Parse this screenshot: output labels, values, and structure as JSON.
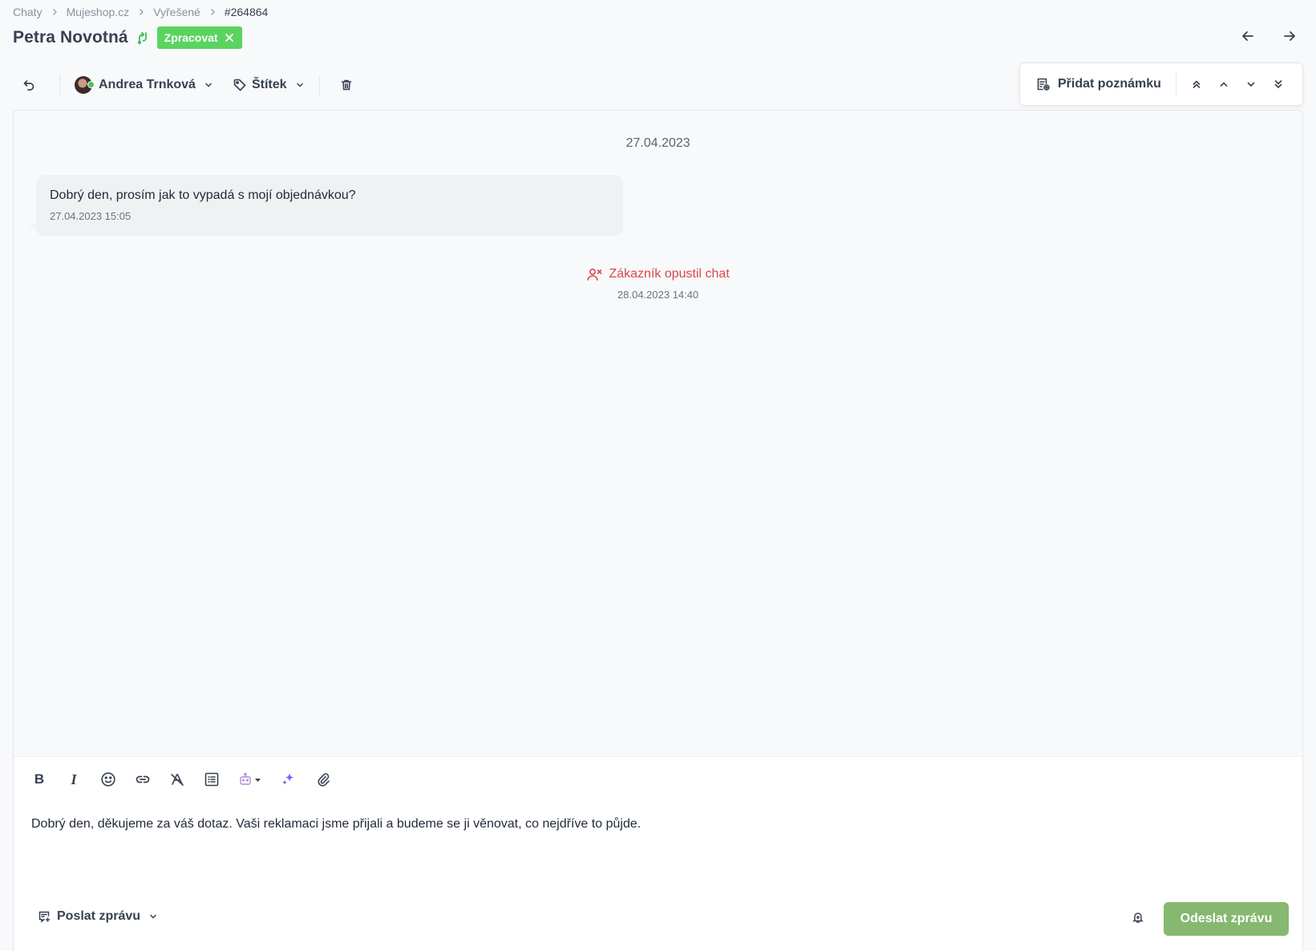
{
  "breadcrumb": {
    "items": [
      "Chaty",
      "Mujeshop.cz",
      "Vyřešené"
    ],
    "current": "#264864"
  },
  "header": {
    "title": "Petra Novotná",
    "status_badge": "Zpracovat"
  },
  "toolbar": {
    "agent_name": "Andrea Trnková",
    "tag_label": "Štítek",
    "add_note_label": "Přidat poznámku"
  },
  "chat": {
    "date_separator": "27.04.2023",
    "messages": [
      {
        "text": "Dobrý den, prosím jak to vypadá s mojí objednávkou?",
        "time": "27.04.2023 15:05"
      }
    ],
    "system_event": {
      "text": "Zákazník opustil chat",
      "time": "28.04.2023 14:40"
    }
  },
  "composer": {
    "message_text": "Dobrý den, děkujeme za váš dotaz. Vaši reklamaci jsme přijali a budeme se ji věnovat, co nejdříve to půjde.",
    "format_bold": "B",
    "format_italic": "I",
    "send_mode_label": "Poslat zprávu",
    "send_button_label": "Odeslat zprávu"
  },
  "colors": {
    "status_badge_bg": "#5ad35f",
    "send_button_bg": "#86b870",
    "system_event_red": "#d9474b",
    "ai_purple": "#8b5cf6"
  },
  "icons": {
    "breadcrumb_separator": "chevron-right-icon",
    "header": [
      "merge-icon",
      "close-icon",
      "arrow-left-icon",
      "arrow-right-icon"
    ],
    "toolbar": [
      "undo-icon",
      "avatar",
      "chevron-down-icon",
      "tag-icon",
      "trash-icon",
      "note-add-icon",
      "chevrons-up-icon",
      "chevron-up-icon",
      "chevron-down-icon",
      "chevrons-down-icon"
    ],
    "format": [
      "bold-icon",
      "italic-icon",
      "emoji-icon",
      "link-icon",
      "clear-format-icon",
      "template-list-icon",
      "bot-icon",
      "sparkles-icon",
      "paperclip-icon"
    ],
    "footer": [
      "message-add-icon",
      "chevron-down-icon",
      "bell-icon"
    ],
    "system_event": "user-x-icon"
  }
}
